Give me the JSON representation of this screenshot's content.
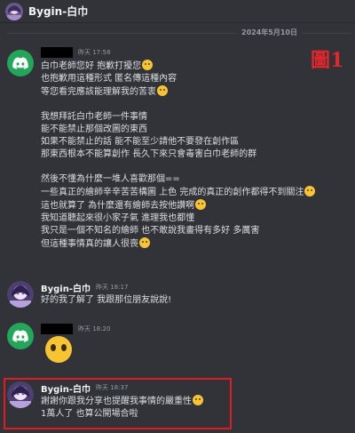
{
  "header": {
    "channel_title": "Bygin-白巾"
  },
  "date_divider": "2024年5月10日",
  "figure_label": "圖1",
  "messages": [
    {
      "author": "",
      "time": "昨天 17:58",
      "lines": [
        "白巾老師您好 抱歉打擾您",
        "也抱歉用這種形式 匿名傳這種內容",
        "等您看完應該能理解我的苦衷",
        "",
        "我想拜託白巾老師一件事情",
        "能不能禁止那個改圖的東西",
        "如果不能禁止的話 能不能至少請他不要發在創作區",
        "那東西根本不能算創作 長久下來只會毒害白巾老師的群",
        "",
        "然後不懂為什麼一堆人喜歡那個==",
        "一些真正的繪師辛辛苦苦構圖 上色 完成的真正的創作都得不到關注",
        "這也就算了 為什麼還有繪師去按他讚啊",
        "我知道聽起來很小家子氣 進理我也都懂",
        "我只是一個不知名的繪師 也不敢說我畫得有多好 多厲害",
        "但這種事情真的讓人很喪"
      ]
    },
    {
      "author": "Bygin-白巾",
      "time": "昨天 18:17",
      "lines": [
        "好的我了解了 我跟那位朋友說說!"
      ]
    },
    {
      "author": "",
      "time": "昨天 18:20",
      "lines": []
    },
    {
      "author": "Bygin-白巾",
      "time": "昨天 18:37",
      "lines": [
        "謝謝你跟我分享也提醒我事情的嚴重性",
        "1萬人了 也算公開場合啦"
      ]
    }
  ]
}
